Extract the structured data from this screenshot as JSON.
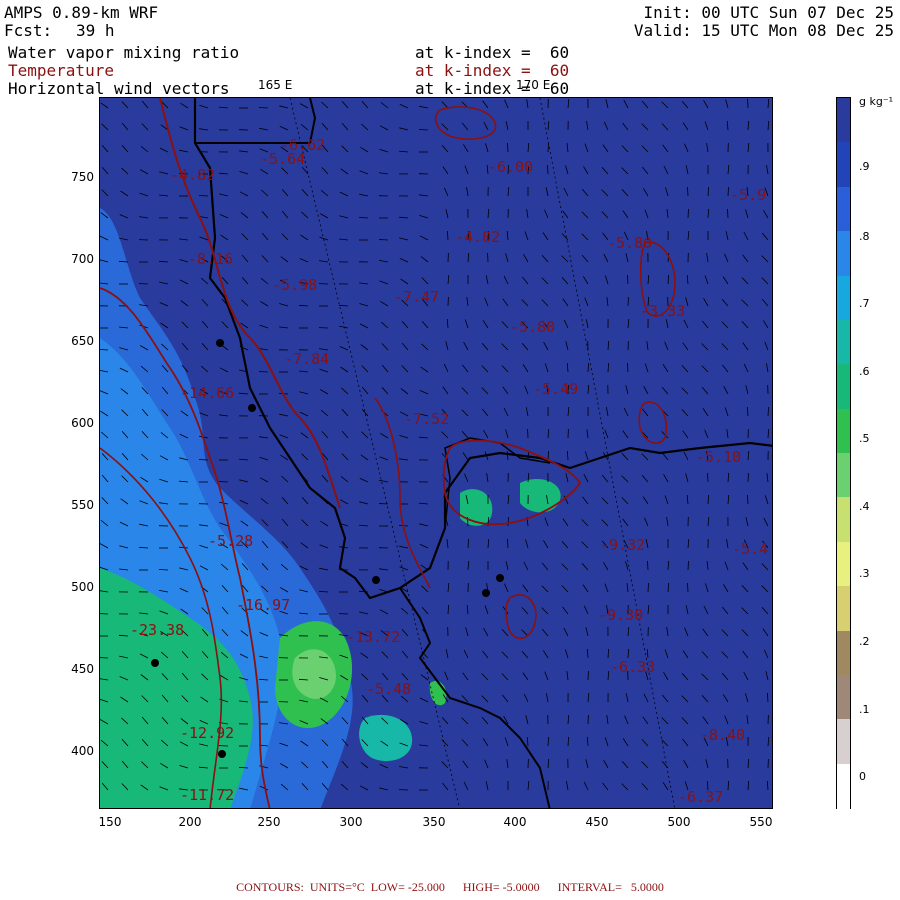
{
  "header": {
    "model": "AMPS 0.89-km WRF",
    "forecast_label": "Fcst:",
    "forecast_value": "39 h",
    "init": "Init: 00 UTC Sun 07 Dec 25",
    "valid": "Valid: 15 UTC Mon 08 Dec 25",
    "fields": [
      {
        "name": "Water vapor mixing ratio",
        "level": "at k-index =  60",
        "color": "#000000"
      },
      {
        "name": "Temperature",
        "level": "at k-index =  60",
        "color": "#8b1010"
      },
      {
        "name": "Horizontal wind vectors",
        "level": "at k-index =  60",
        "color": "#000000"
      }
    ],
    "lon_labels": [
      "165 E",
      "170 E"
    ]
  },
  "axes": {
    "x_ticks": [
      "150",
      "200",
      "250",
      "300",
      "350",
      "400",
      "450",
      "500",
      "550"
    ],
    "y_ticks": [
      "750",
      "700",
      "650",
      "600",
      "550",
      "500",
      "450",
      "400"
    ]
  },
  "colorbar": {
    "unit": "g kg⁻¹",
    "labels": [
      ".9",
      ".8",
      ".7",
      ".6",
      ".5",
      ".4",
      ".3",
      ".2",
      ".1",
      "0"
    ],
    "colors": [
      "#2a3b9e",
      "#2244b8",
      "#2a5fd8",
      "#2a86e8",
      "#18a8e0",
      "#18b8a8",
      "#18b878",
      "#30c050",
      "#6ad070",
      "#c8e070",
      "#e8f080",
      "#d8d070",
      "#a08860",
      "#a08878",
      "#d8d0d0",
      "#ffffff"
    ]
  },
  "map": {
    "background": "#2a3b9e",
    "contour_labels": [
      {
        "t": "-6.62"
      },
      {
        "t": "-5.64"
      },
      {
        "t": "-4.82"
      },
      {
        "t": "-6.00"
      },
      {
        "t": "-5.9"
      },
      {
        "t": "-4.02"
      },
      {
        "t": "-5.80"
      },
      {
        "t": "-8.16"
      },
      {
        "t": "-5.98"
      },
      {
        "t": "-7.47"
      },
      {
        "t": "-5.80"
      },
      {
        "t": "-3.33"
      },
      {
        "t": "-7.84"
      },
      {
        "t": "-5.49"
      },
      {
        "t": "-14.66"
      },
      {
        "t": "-7.52"
      },
      {
        "t": "-5.10"
      },
      {
        "t": "-23.38"
      },
      {
        "t": "-16.97"
      },
      {
        "t": "-13.72"
      },
      {
        "t": "-5.48"
      },
      {
        "t": "-9.30"
      },
      {
        "t": "-9.32"
      },
      {
        "t": "-12.92"
      },
      {
        "t": "-11.72"
      },
      {
        "t": "-8.40"
      },
      {
        "t": "-6.37"
      },
      {
        "t": "-5.4"
      },
      {
        "t": "-5.28"
      },
      {
        "t": "-6.33"
      }
    ]
  },
  "footer": "CONTOURS:  UNITS=°C  LOW= -25.000      HIGH= -5.0000      INTERVAL=   5.0000"
}
